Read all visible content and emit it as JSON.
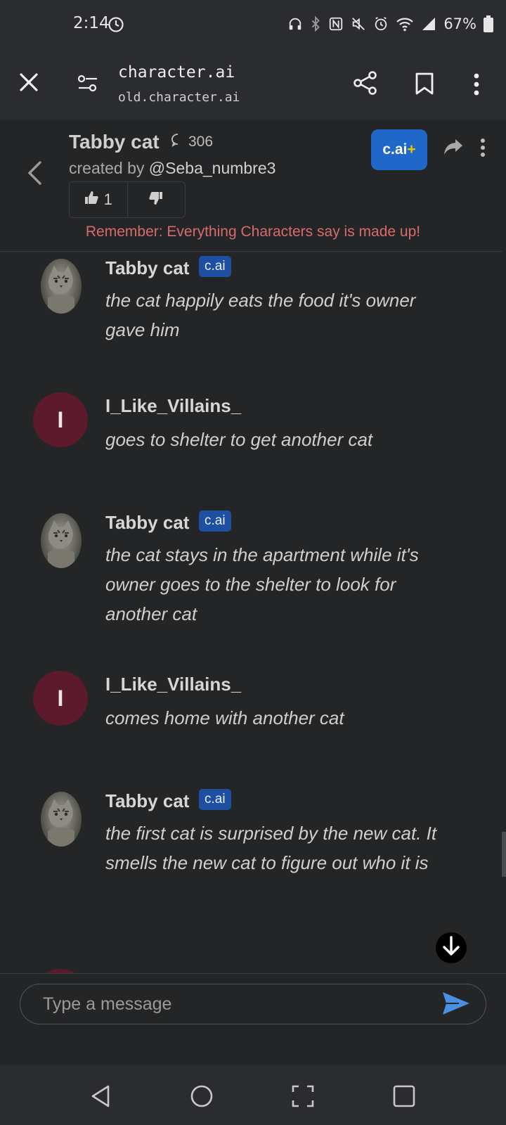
{
  "status_bar": {
    "time": "2:14",
    "battery": "67%"
  },
  "browser": {
    "title": "character.ai",
    "url": "old.character.ai"
  },
  "character": {
    "name": "Tabby cat",
    "chat_count": "306",
    "created_by_prefix": "created by ",
    "creator_handle": "@Seba_numbre3",
    "likes": "1",
    "plus_label": "c.ai",
    "plus_suffix": "+",
    "reminder": "Remember: Everything Characters say is made up!"
  },
  "badge_label": "c.ai",
  "messages": [
    {
      "author": "Tabby cat",
      "is_bot": true,
      "text": "the cat happily eats the food it's owner gave him"
    },
    {
      "author": "I_Like_Villains_",
      "is_bot": false,
      "initial": "I",
      "text": "goes to shelter to get another cat"
    },
    {
      "author": "Tabby cat",
      "is_bot": true,
      "text": "the cat stays in the apartment while it's owner goes to the shelter to look for another cat"
    },
    {
      "author": "I_Like_Villains_",
      "is_bot": false,
      "initial": "I",
      "text": "comes home with another cat"
    },
    {
      "author": "Tabby cat",
      "is_bot": true,
      "text": "the first cat is surprised by the new cat. It smells the new cat to figure out who it is"
    }
  ],
  "composer": {
    "placeholder": "Type a message"
  },
  "colors": {
    "background": "#242526",
    "bar": "#2b2c30",
    "user_avatar": "#5e1a2d",
    "badge": "#1e4fa0",
    "plus_button": "#1f67c8",
    "reminder": "#d76b6b",
    "send": "#4a90e2"
  }
}
